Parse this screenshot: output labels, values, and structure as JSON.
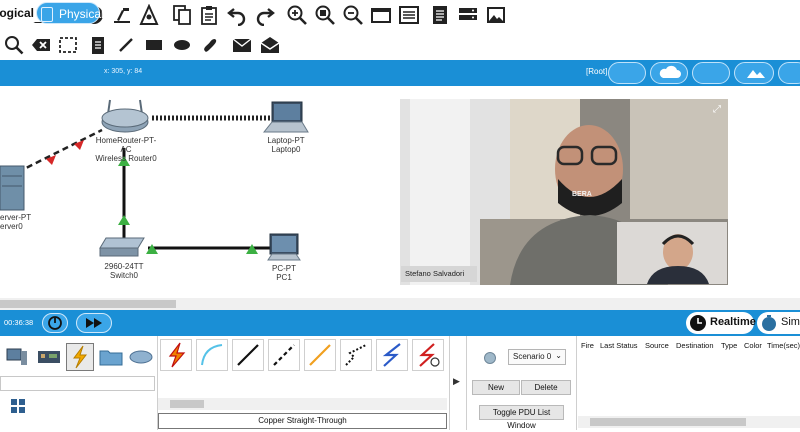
{
  "toolbar_top": {
    "icons": [
      "open-folder-icon",
      "save-icon",
      "print-icon",
      "info-icon",
      "custom-device-icon",
      "network-graph-icon",
      "copy-icon",
      "paste-icon",
      "undo-icon",
      "redo-icon",
      "zoom-in-icon",
      "zoom-reset-icon",
      "zoom-out-icon",
      "window-icon",
      "list-icon",
      "document-icon",
      "equipment-icon",
      "image-icon"
    ]
  },
  "toolbar_bottom": {
    "icons": [
      "inspect-icon",
      "delete-icon",
      "select-icon",
      "note-icon",
      "line-icon",
      "rectangle-icon",
      "ellipse-icon",
      "freeform-icon",
      "add-simple-pdu-icon",
      "add-complex-pdu-icon"
    ]
  },
  "tabs": {
    "logical": "ogical",
    "physical": "Physical"
  },
  "workspace": {
    "coords": "x: 305, y: 84",
    "root": "[Root]",
    "devices": [
      {
        "line1": "HomeRouter-PT-AC",
        "line2": "Wireless Router0"
      },
      {
        "line1": "Laptop-PT",
        "line2": "Laptop0"
      },
      {
        "line1": "erver-PT",
        "line2": "erver0"
      },
      {
        "line1": "2960-24TT",
        "line2": "Switch0"
      },
      {
        "line1": "PC-PT",
        "line2": "PC1"
      }
    ]
  },
  "video": {
    "participant_name": "Stefano Salvadori",
    "mask_text": "BERA"
  },
  "realtime": {
    "time": "00:36:38",
    "realtime_label": "Realtime",
    "simulation_label": "Simul"
  },
  "bottom": {
    "connection_label": "Copper Straight-Through",
    "scenario": "Scenario 0",
    "new_label": "New",
    "delete_label": "Delete",
    "toggle_label": "Toggle PDU List Window",
    "columns": [
      "Fire",
      "Last Status",
      "Source",
      "Destination",
      "Type",
      "Color",
      "Time(sec)"
    ]
  },
  "colors": {
    "accent": "#1a8fd6",
    "link_green": "#3cb043",
    "link_red": "#d62828"
  }
}
